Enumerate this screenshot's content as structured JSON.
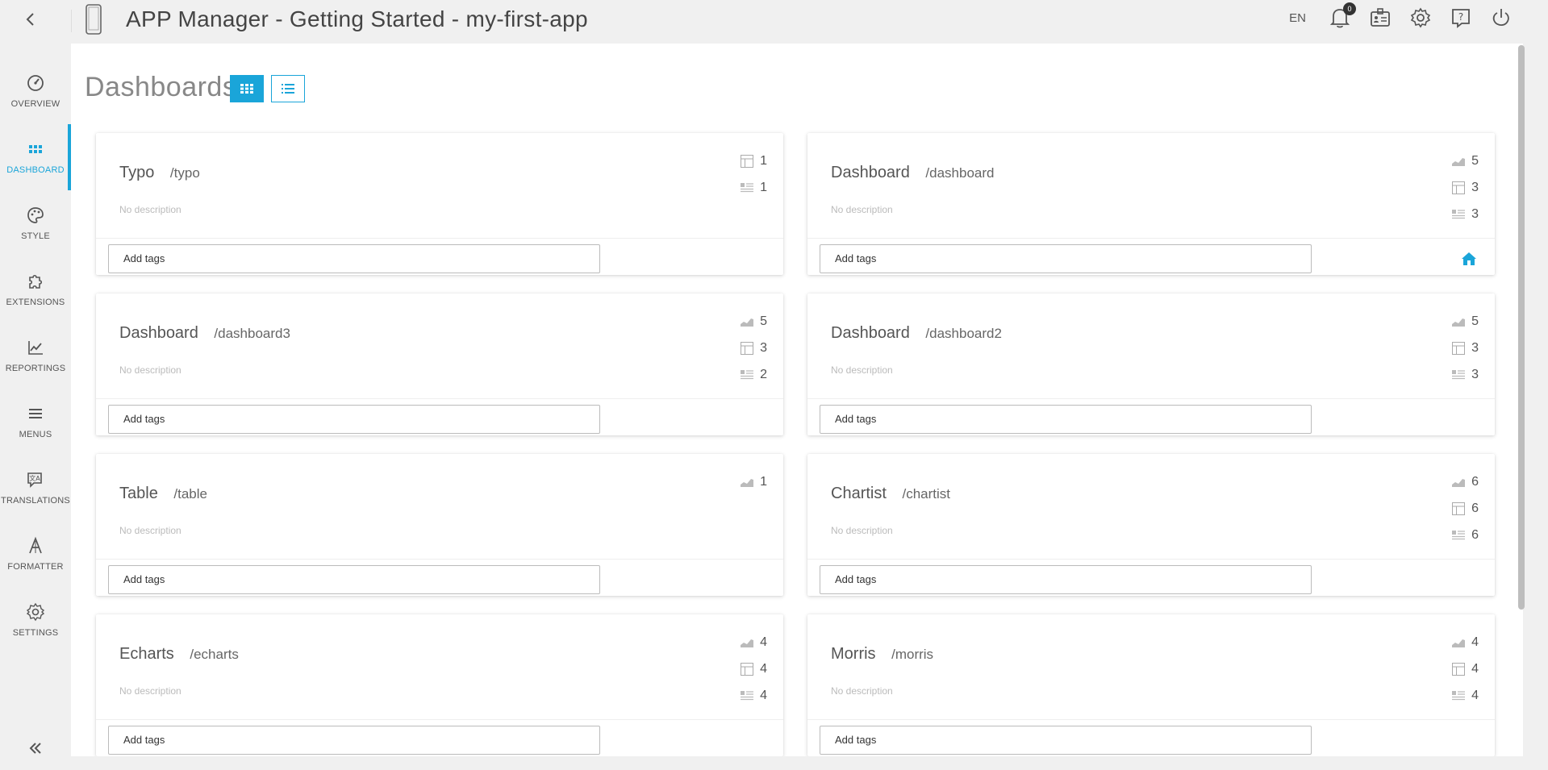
{
  "header": {
    "title": "APP Manager - Getting Started - my-first-app",
    "language": "EN",
    "notification_count": "0"
  },
  "sidebar": {
    "items": [
      {
        "label": "OVERVIEW",
        "icon": "gauge-icon"
      },
      {
        "label": "DASHBOARD",
        "icon": "grid-dots-icon",
        "active": true
      },
      {
        "label": "STYLE",
        "icon": "palette-icon"
      },
      {
        "label": "EXTENSIONS",
        "icon": "puzzle-icon"
      },
      {
        "label": "REPORTINGS",
        "icon": "line-chart-icon"
      },
      {
        "label": "MENUS",
        "icon": "menu-icon"
      },
      {
        "label": "TRANSLATIONS",
        "icon": "translate-icon"
      },
      {
        "label": "FORMATTER",
        "icon": "formatter-icon"
      },
      {
        "label": "SETTINGS",
        "icon": "gear-icon"
      }
    ]
  },
  "page": {
    "title": "Dashboards",
    "tag_placeholder": "Add tags",
    "description": "No description"
  },
  "dashboards": [
    {
      "name": "Typo",
      "path": "/typo",
      "charts": null,
      "tables": "1",
      "texts": "1",
      "home": false
    },
    {
      "name": "Dashboard",
      "path": "/dashboard",
      "charts": "5",
      "tables": "3",
      "texts": "3",
      "home": true
    },
    {
      "name": "Dashboard",
      "path": "/dashboard3",
      "charts": "5",
      "tables": "3",
      "texts": "2",
      "home": false
    },
    {
      "name": "Dashboard",
      "path": "/dashboard2",
      "charts": "5",
      "tables": "3",
      "texts": "3",
      "home": false
    },
    {
      "name": "Table",
      "path": "/table",
      "charts": "1",
      "tables": null,
      "texts": null,
      "home": false
    },
    {
      "name": "Chartist",
      "path": "/chartist",
      "charts": "6",
      "tables": "6",
      "texts": "6",
      "home": false
    },
    {
      "name": "Echarts",
      "path": "/echarts",
      "charts": "4",
      "tables": "4",
      "texts": "4",
      "home": false
    },
    {
      "name": "Morris",
      "path": "/morris",
      "charts": "4",
      "tables": "4",
      "texts": "4",
      "home": false
    }
  ],
  "colors": {
    "accent": "#1aa5d9",
    "background": "#f0f0f0",
    "panel": "#ffffff"
  }
}
